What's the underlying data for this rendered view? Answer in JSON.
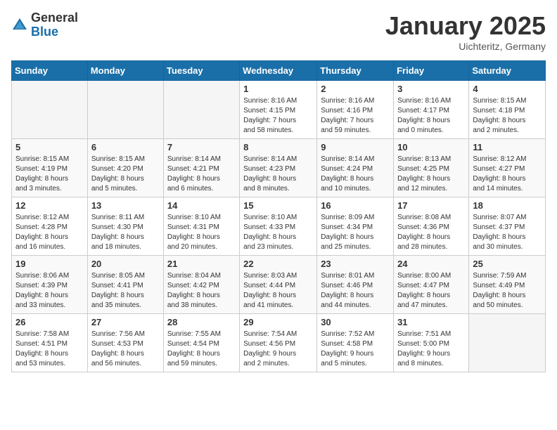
{
  "logo": {
    "general": "General",
    "blue": "Blue"
  },
  "title": "January 2025",
  "location": "Uichteritz, Germany",
  "weekdays": [
    "Sunday",
    "Monday",
    "Tuesday",
    "Wednesday",
    "Thursday",
    "Friday",
    "Saturday"
  ],
  "weeks": [
    [
      {
        "day": "",
        "info": ""
      },
      {
        "day": "",
        "info": ""
      },
      {
        "day": "",
        "info": ""
      },
      {
        "day": "1",
        "info": "Sunrise: 8:16 AM\nSunset: 4:15 PM\nDaylight: 7 hours\nand 58 minutes."
      },
      {
        "day": "2",
        "info": "Sunrise: 8:16 AM\nSunset: 4:16 PM\nDaylight: 7 hours\nand 59 minutes."
      },
      {
        "day": "3",
        "info": "Sunrise: 8:16 AM\nSunset: 4:17 PM\nDaylight: 8 hours\nand 0 minutes."
      },
      {
        "day": "4",
        "info": "Sunrise: 8:15 AM\nSunset: 4:18 PM\nDaylight: 8 hours\nand 2 minutes."
      }
    ],
    [
      {
        "day": "5",
        "info": "Sunrise: 8:15 AM\nSunset: 4:19 PM\nDaylight: 8 hours\nand 3 minutes."
      },
      {
        "day": "6",
        "info": "Sunrise: 8:15 AM\nSunset: 4:20 PM\nDaylight: 8 hours\nand 5 minutes."
      },
      {
        "day": "7",
        "info": "Sunrise: 8:14 AM\nSunset: 4:21 PM\nDaylight: 8 hours\nand 6 minutes."
      },
      {
        "day": "8",
        "info": "Sunrise: 8:14 AM\nSunset: 4:23 PM\nDaylight: 8 hours\nand 8 minutes."
      },
      {
        "day": "9",
        "info": "Sunrise: 8:14 AM\nSunset: 4:24 PM\nDaylight: 8 hours\nand 10 minutes."
      },
      {
        "day": "10",
        "info": "Sunrise: 8:13 AM\nSunset: 4:25 PM\nDaylight: 8 hours\nand 12 minutes."
      },
      {
        "day": "11",
        "info": "Sunrise: 8:12 AM\nSunset: 4:27 PM\nDaylight: 8 hours\nand 14 minutes."
      }
    ],
    [
      {
        "day": "12",
        "info": "Sunrise: 8:12 AM\nSunset: 4:28 PM\nDaylight: 8 hours\nand 16 minutes."
      },
      {
        "day": "13",
        "info": "Sunrise: 8:11 AM\nSunset: 4:30 PM\nDaylight: 8 hours\nand 18 minutes."
      },
      {
        "day": "14",
        "info": "Sunrise: 8:10 AM\nSunset: 4:31 PM\nDaylight: 8 hours\nand 20 minutes."
      },
      {
        "day": "15",
        "info": "Sunrise: 8:10 AM\nSunset: 4:33 PM\nDaylight: 8 hours\nand 23 minutes."
      },
      {
        "day": "16",
        "info": "Sunrise: 8:09 AM\nSunset: 4:34 PM\nDaylight: 8 hours\nand 25 minutes."
      },
      {
        "day": "17",
        "info": "Sunrise: 8:08 AM\nSunset: 4:36 PM\nDaylight: 8 hours\nand 28 minutes."
      },
      {
        "day": "18",
        "info": "Sunrise: 8:07 AM\nSunset: 4:37 PM\nDaylight: 8 hours\nand 30 minutes."
      }
    ],
    [
      {
        "day": "19",
        "info": "Sunrise: 8:06 AM\nSunset: 4:39 PM\nDaylight: 8 hours\nand 33 minutes."
      },
      {
        "day": "20",
        "info": "Sunrise: 8:05 AM\nSunset: 4:41 PM\nDaylight: 8 hours\nand 35 minutes."
      },
      {
        "day": "21",
        "info": "Sunrise: 8:04 AM\nSunset: 4:42 PM\nDaylight: 8 hours\nand 38 minutes."
      },
      {
        "day": "22",
        "info": "Sunrise: 8:03 AM\nSunset: 4:44 PM\nDaylight: 8 hours\nand 41 minutes."
      },
      {
        "day": "23",
        "info": "Sunrise: 8:01 AM\nSunset: 4:46 PM\nDaylight: 8 hours\nand 44 minutes."
      },
      {
        "day": "24",
        "info": "Sunrise: 8:00 AM\nSunset: 4:47 PM\nDaylight: 8 hours\nand 47 minutes."
      },
      {
        "day": "25",
        "info": "Sunrise: 7:59 AM\nSunset: 4:49 PM\nDaylight: 8 hours\nand 50 minutes."
      }
    ],
    [
      {
        "day": "26",
        "info": "Sunrise: 7:58 AM\nSunset: 4:51 PM\nDaylight: 8 hours\nand 53 minutes."
      },
      {
        "day": "27",
        "info": "Sunrise: 7:56 AM\nSunset: 4:53 PM\nDaylight: 8 hours\nand 56 minutes."
      },
      {
        "day": "28",
        "info": "Sunrise: 7:55 AM\nSunset: 4:54 PM\nDaylight: 8 hours\nand 59 minutes."
      },
      {
        "day": "29",
        "info": "Sunrise: 7:54 AM\nSunset: 4:56 PM\nDaylight: 9 hours\nand 2 minutes."
      },
      {
        "day": "30",
        "info": "Sunrise: 7:52 AM\nSunset: 4:58 PM\nDaylight: 9 hours\nand 5 minutes."
      },
      {
        "day": "31",
        "info": "Sunrise: 7:51 AM\nSunset: 5:00 PM\nDaylight: 9 hours\nand 8 minutes."
      },
      {
        "day": "",
        "info": ""
      }
    ]
  ]
}
